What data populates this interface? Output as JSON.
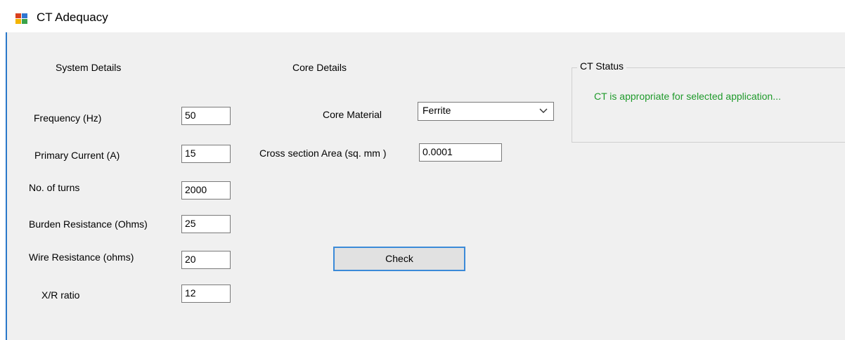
{
  "window": {
    "title": "CT Adequacy",
    "icon": "app-icon"
  },
  "system": {
    "heading": "System Details",
    "fields": [
      {
        "label": "Frequency (Hz)",
        "value": "50"
      },
      {
        "label": "Primary Current (A)",
        "value": "15"
      },
      {
        "label": "No. of turns",
        "value": "2000"
      },
      {
        "label": "Burden Resistance (Ohms)",
        "value": "25"
      },
      {
        "label": "Wire Resistance (ohms)",
        "value": "20"
      },
      {
        "label": "X/R ratio",
        "value": "12"
      }
    ]
  },
  "core": {
    "heading": "Core Details",
    "material_label": "Core Material",
    "material_value": "Ferrite",
    "area_label": "Cross section Area (sq. mm )",
    "area_value": "0.0001"
  },
  "actions": {
    "check_label": "Check"
  },
  "status": {
    "group_title": "CT Status",
    "message": "CT is appropriate for selected application...",
    "message_color": "#1f9a2b"
  }
}
